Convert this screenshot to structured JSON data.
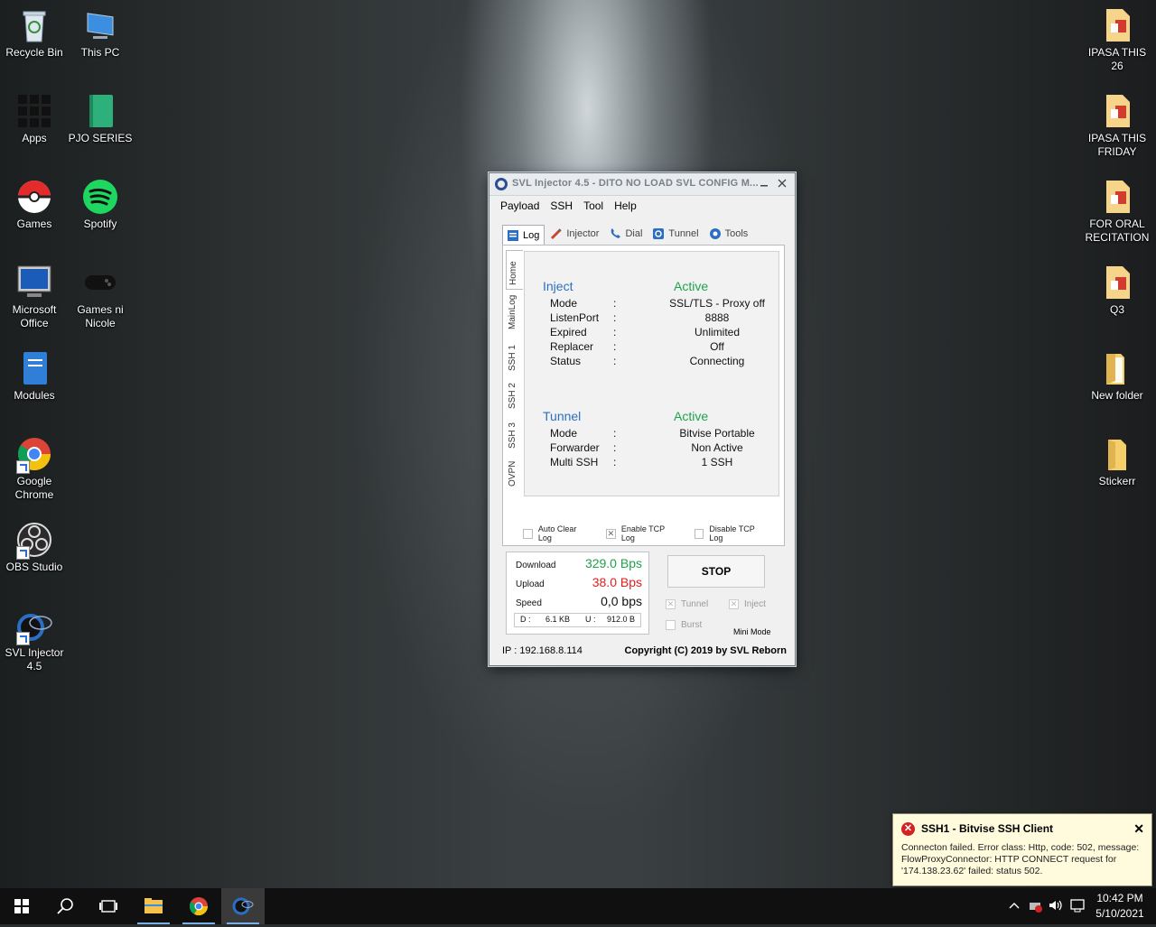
{
  "desktop_left": [
    {
      "label": "Recycle Bin",
      "icon": "recycle-bin-icon"
    },
    {
      "label": "This PC",
      "icon": "this-pc-icon"
    },
    {
      "label": "Apps",
      "icon": "apps-grid-icon"
    },
    {
      "label": "PJO SERIES",
      "icon": "book-icon"
    },
    {
      "label": "Games",
      "icon": "pokeball-icon"
    },
    {
      "label": "Spotify",
      "icon": "spotify-icon"
    },
    {
      "label": "Microsoft Office",
      "icon": "monitor-icon"
    },
    {
      "label": "Games ni Nicole",
      "icon": "gamepad-icon"
    },
    {
      "label": "Modules",
      "icon": "notebook-icon"
    },
    {
      "label": "Google Chrome",
      "icon": "chrome-icon"
    },
    {
      "label": "OBS Studio",
      "icon": "obs-icon"
    },
    {
      "label": "SVL Injector 4.5",
      "icon": "svl-icon"
    }
  ],
  "desktop_right": [
    {
      "label": "IPASA THIS 26",
      "icon": "office-file-icon"
    },
    {
      "label": "IPASA THIS FRIDAY",
      "icon": "office-file-icon"
    },
    {
      "label": "FOR ORAL RECITATION",
      "icon": "office-file-icon"
    },
    {
      "label": "Q3",
      "icon": "office-file-icon"
    },
    {
      "label": "New folder",
      "icon": "folder-icon"
    },
    {
      "label": "Stickerr",
      "icon": "folder-icon"
    }
  ],
  "window": {
    "title": "SVL Injector 4.5 - DITO NO LOAD SVL CONFIG M...",
    "menu": [
      "Payload",
      "SSH",
      "Tool",
      "Help"
    ],
    "tabs": [
      {
        "label": "Log",
        "icon": "log-icon",
        "active": true
      },
      {
        "label": "Injector",
        "icon": "syringe-icon",
        "active": false
      },
      {
        "label": "Dial",
        "icon": "phone-icon",
        "active": false
      },
      {
        "label": "Tunnel",
        "icon": "tunnel-icon",
        "active": false
      },
      {
        "label": "Tools",
        "icon": "tools-icon",
        "active": false
      }
    ],
    "side_tabs": [
      "Home",
      "MainLog",
      "SSH 1",
      "SSH 2",
      "SSH 3",
      "OVPN"
    ],
    "inject": {
      "heading": "Inject",
      "state": "Active",
      "rows": [
        {
          "key": "Mode",
          "value": "SSL/TLS - Proxy off"
        },
        {
          "key": "ListenPort",
          "value": "8888"
        },
        {
          "key": "Expired",
          "value": "Unlimited"
        },
        {
          "key": "Replacer",
          "value": "Off"
        },
        {
          "key": "Status",
          "value": "Connecting"
        }
      ]
    },
    "tunnel": {
      "heading": "Tunnel",
      "state": "Active",
      "rows": [
        {
          "key": "Mode",
          "value": "Bitvise Portable"
        },
        {
          "key": "Forwarder",
          "value": "Non Active"
        },
        {
          "key": "Multi SSH",
          "value": "1 SSH"
        }
      ]
    },
    "separator": ":",
    "checkboxes": [
      {
        "label": "Auto Clear Log",
        "checked": false
      },
      {
        "label": "Enable TCP Log",
        "checked": true
      },
      {
        "label": "Disable TCP Log",
        "checked": false
      }
    ],
    "stats": {
      "download_label": "Download",
      "download_value": "329.0 Bps",
      "upload_label": "Upload",
      "upload_value": "38.0 Bps",
      "speed_label": "Speed",
      "speed_value": "0,0 bps",
      "d_label": "D :",
      "d_value": "6.1 KB",
      "u_label": "U :",
      "u_value": "912.0 B"
    },
    "stop_label": "STOP",
    "tunnel_chk": "Tunnel",
    "inject_chk": "Inject",
    "burst_chk": "Burst",
    "mini_mode": "Mini Mode",
    "ip": "IP : 192.168.8.114",
    "copyright": "Copyright (C) 2019 by SVL Reborn"
  },
  "notification": {
    "title": "SSH1 - Bitvise SSH Client",
    "message": "Connecton failed. Error class: Http, code: 502, message: FlowProxyConnector: HTTP CONNECT request for '174.138.23.62' failed: status 502."
  },
  "clock": {
    "time": "10:42 PM",
    "date": "5/10/2021"
  },
  "colors": {
    "inject_blue": "#2c6fc2",
    "active_green": "#1ea24a",
    "download_green": "#1ea24a",
    "upload_red": "#e02020"
  }
}
